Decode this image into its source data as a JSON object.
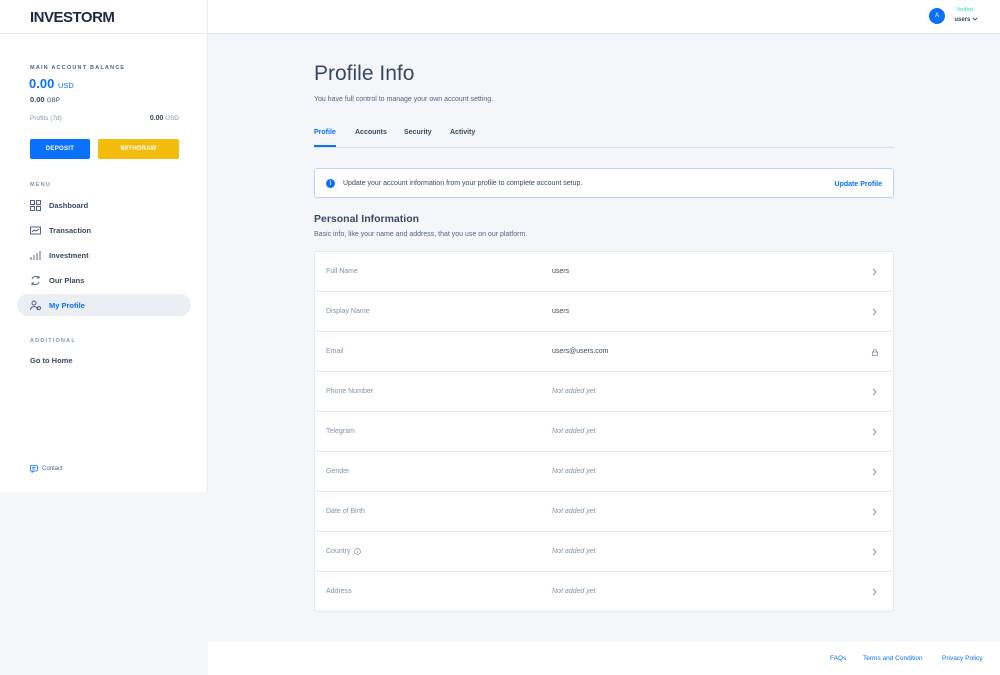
{
  "brand": {
    "name": "INVESTORM"
  },
  "sidebar": {
    "balance_label": "MAIN ACCOUNT BALANCE",
    "balance_usd": "0.00",
    "currency_usd": "USD",
    "balance_gbp": "0.00",
    "currency_gbp": "GBP",
    "profits_label": "Profits (7d)",
    "profits_value": "0.00",
    "profits_currency": "USD",
    "deposit_label": "DEPOSIT",
    "withdraw_label": "WITHDRAW",
    "menu_label": "MENU",
    "items": [
      {
        "label": "Dashboard",
        "icon": "dashboard-icon"
      },
      {
        "label": "Transaction",
        "icon": "transaction-icon"
      },
      {
        "label": "Investment",
        "icon": "investment-icon"
      },
      {
        "label": "Our Plans",
        "icon": "plans-icon"
      },
      {
        "label": "My Profile",
        "icon": "profile-icon",
        "active": true
      }
    ],
    "additional_label": "ADDITIONAL",
    "go_home": "Go to Home",
    "contact": "Contact"
  },
  "header": {
    "avatar_initial": "A",
    "status": "Verified",
    "username": "users"
  },
  "main": {
    "title": "Profile Info",
    "subtitle": "You have full control to manage your own account setting.",
    "tabs": [
      "Profile",
      "Accounts",
      "Security",
      "Activity"
    ],
    "alert": {
      "message": "Update your account information from your profile to complete account setup.",
      "action": "Update Profile"
    },
    "section_title": "Personal Information",
    "section_subtitle": "Basic info, like your name and address, that you use on our platform.",
    "fields": [
      {
        "label": "Full Name",
        "value": "users",
        "action": "chevron-right-icon"
      },
      {
        "label": "Display Name",
        "value": "users",
        "action": "chevron-right-icon"
      },
      {
        "label": "Email",
        "value": "users@users.com",
        "action": "lock-icon"
      },
      {
        "label": "Phone Number",
        "value": "Not added yet",
        "action": "chevron-right-icon"
      },
      {
        "label": "Telegram",
        "value": "Not added yet",
        "action": "chevron-right-icon"
      },
      {
        "label": "Gender",
        "value": "Not added yet",
        "action": "chevron-right-icon"
      },
      {
        "label": "Date of Birth",
        "value": "Not added yet",
        "action": "chevron-right-icon"
      },
      {
        "label": "Country",
        "value": "Not added yet",
        "action": "chevron-right-icon"
      },
      {
        "label": "Address",
        "value": "Not added yet",
        "action": "chevron-right-icon"
      }
    ]
  },
  "footer": {
    "links": [
      "FAQs",
      "Terms and Condition",
      "Privacy Policy"
    ]
  },
  "colors": {
    "primary": "#0971fe",
    "warning": "#f4bd0e",
    "success": "#1ee0ac"
  }
}
